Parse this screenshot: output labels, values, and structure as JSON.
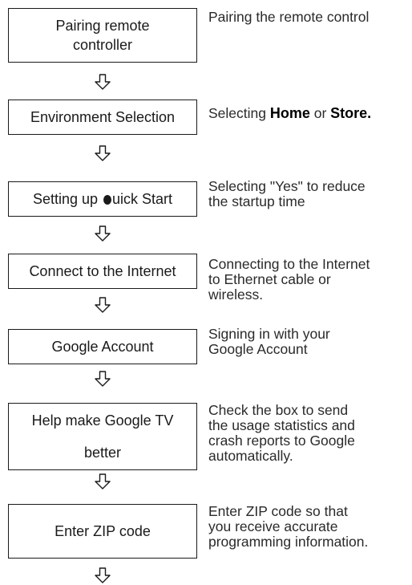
{
  "steps": [
    {
      "label": "Pairing remote\ncontroller",
      "description": "Pairing the remote control"
    },
    {
      "label": "Environment Selection",
      "description_pre": "Selecting ",
      "description_home": "Home",
      "description_mid": " or ",
      "description_store": "Store."
    },
    {
      "label_pre": "Setting up ",
      "label_post": "uick Start",
      "description": "Selecting \"Yes\" to reduce\nthe startup time"
    },
    {
      "label": "Connect to the Internet",
      "description": "Connecting to the Internet\nto Ethernet cable or\nwireless."
    },
    {
      "label": "Google Account",
      "description": "Signing in with your\nGoogle Account"
    },
    {
      "label_line1": "Help make Google TV",
      "label_line2": "better",
      "description": "Check the box to send\nthe usage statistics and\ncrash reports to Google\nautomatically."
    },
    {
      "label": "Enter ZIP code",
      "description": "Enter ZIP code so that\nyou receive accurate\nprogramming information."
    }
  ],
  "arrow_icon": "down-arrow-icon"
}
